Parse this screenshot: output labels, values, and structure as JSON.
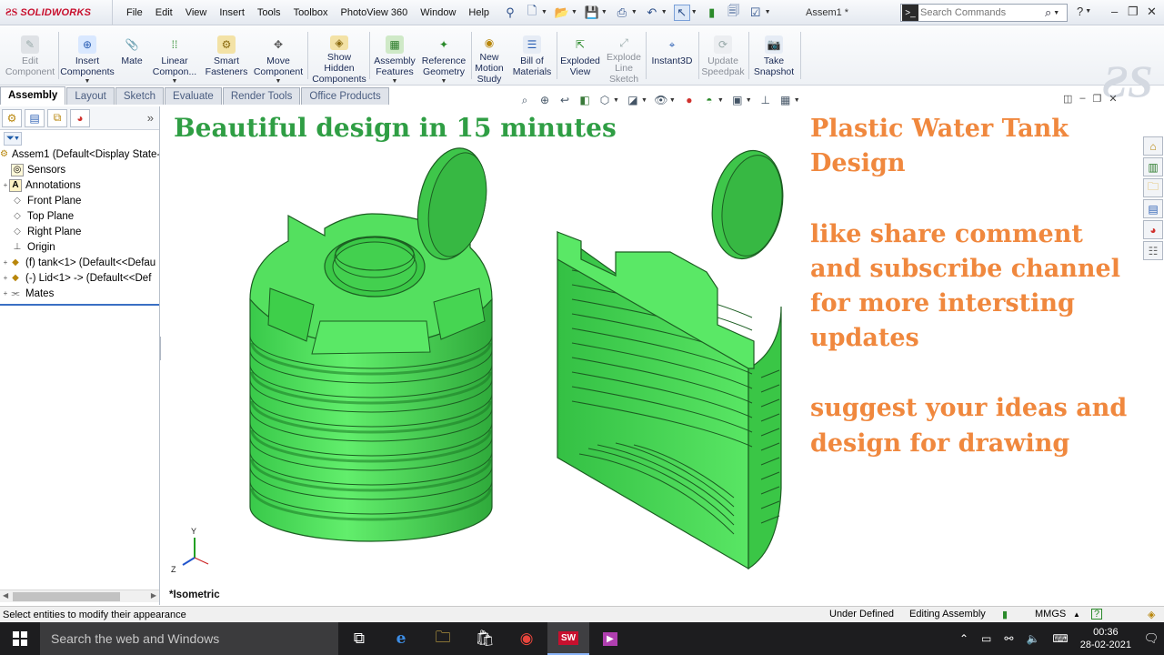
{
  "app": {
    "brand": "SOLIDWORKS",
    "document_title": "Assem1 *",
    "menus": [
      "File",
      "Edit",
      "View",
      "Insert",
      "Tools",
      "Toolbox",
      "PhotoView 360",
      "Window",
      "Help"
    ],
    "search_placeholder": "Search Commands"
  },
  "command_manager": {
    "buttons": [
      {
        "label": "Edit\nComponent",
        "icon": "edit-component-icon",
        "enabled": false
      },
      {
        "label": "Insert\nComponents",
        "icon": "insert-components-icon",
        "enabled": true
      },
      {
        "label": "Mate",
        "icon": "mate-icon",
        "enabled": true
      },
      {
        "label": "Linear\nCompon...",
        "icon": "linear-pattern-icon",
        "enabled": true
      },
      {
        "label": "Smart\nFasteners",
        "icon": "smart-fasteners-icon",
        "enabled": true
      },
      {
        "label": "Move\nComponent",
        "icon": "move-component-icon",
        "enabled": true
      },
      {
        "label": "Show\nHidden\nComponents",
        "icon": "show-hidden-icon",
        "enabled": true
      },
      {
        "label": "Assembly\nFeatures",
        "icon": "assembly-features-icon",
        "enabled": true
      },
      {
        "label": "Reference\nGeometry",
        "icon": "reference-geometry-icon",
        "enabled": true
      },
      {
        "label": "New\nMotion\nStudy",
        "icon": "motion-study-icon",
        "enabled": true
      },
      {
        "label": "Bill of\nMaterials",
        "icon": "bom-icon",
        "enabled": true
      },
      {
        "label": "Exploded\nView",
        "icon": "exploded-view-icon",
        "enabled": true
      },
      {
        "label": "Explode\nLine\nSketch",
        "icon": "explode-line-icon",
        "enabled": false
      },
      {
        "label": "Instant3D",
        "icon": "instant3d-icon",
        "enabled": true
      },
      {
        "label": "Update\nSpeedpak",
        "icon": "speedpak-icon",
        "enabled": false
      },
      {
        "label": "Take\nSnapshot",
        "icon": "snapshot-icon",
        "enabled": true
      }
    ]
  },
  "tabs": [
    {
      "label": "Assembly",
      "active": true
    },
    {
      "label": "Layout",
      "active": false
    },
    {
      "label": "Sketch",
      "active": false
    },
    {
      "label": "Evaluate",
      "active": false
    },
    {
      "label": "Render Tools",
      "active": false
    },
    {
      "label": "Office Products",
      "active": false
    }
  ],
  "feature_tree": {
    "items": [
      {
        "label": "Assem1  (Default<Display State-",
        "icon": "assembly-icon",
        "expander": ""
      },
      {
        "label": "Sensors",
        "icon": "sensors-icon",
        "expander": ""
      },
      {
        "label": "Annotations",
        "icon": "annotations-icon",
        "expander": "+"
      },
      {
        "label": "Front Plane",
        "icon": "plane-icon",
        "expander": ""
      },
      {
        "label": "Top Plane",
        "icon": "plane-icon",
        "expander": ""
      },
      {
        "label": "Right Plane",
        "icon": "plane-icon",
        "expander": ""
      },
      {
        "label": "Origin",
        "icon": "origin-icon",
        "expander": ""
      },
      {
        "label": "(f) tank<1> (Default<<Defau",
        "icon": "part-icon",
        "expander": "+"
      },
      {
        "label": "(-) Lid<1> -> (Default<<Def",
        "icon": "part-icon",
        "expander": "+"
      },
      {
        "label": "Mates",
        "icon": "mates-icon",
        "expander": "+"
      }
    ]
  },
  "viewport": {
    "headline": "Beautiful design in 15 minutes",
    "overlay_lines": [
      "Plastic Water Tank",
      "Design",
      "",
      "like share comment",
      "and subscribe channel",
      "for more intersting",
      "updates",
      "",
      "suggest your ideas and",
      "design for drawing"
    ],
    "view_label": "*Isometric",
    "triad_y": "Y",
    "triad_z": "Z",
    "colors": {
      "headline": "#2f9e44",
      "overlay": "#f0883e",
      "part": "#54e05f"
    }
  },
  "statusbar": {
    "message": "Select entities to modify their appearance",
    "state": "Under Defined",
    "mode": "Editing Assembly",
    "units": "MMGS"
  },
  "taskbar": {
    "search_placeholder": "Search the web and Windows",
    "time": "00:36",
    "date": "28-02-2021"
  }
}
